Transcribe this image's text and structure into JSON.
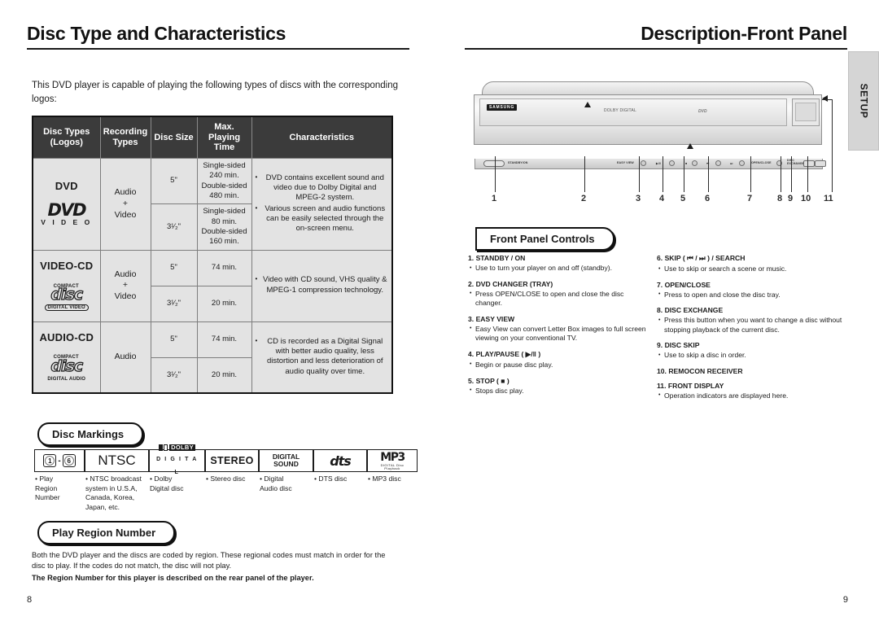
{
  "left": {
    "title": "Disc Type and Characteristics",
    "intro": "This DVD player is capable of playing the following types of discs with the corresponding logos:",
    "page_number": "8",
    "table": {
      "headers": [
        {
          "line1": "Disc Types",
          "line2": "(Logos)"
        },
        {
          "line1": "Recording",
          "line2": "Types"
        },
        {
          "line1": "Disc Size",
          "line2": ""
        },
        {
          "line1": "Max.",
          "line2": "Playing Time"
        },
        {
          "line1": "Characteristics",
          "line2": ""
        }
      ],
      "rows": [
        {
          "disc_type": "DVD",
          "logo": "dvd-video-logo",
          "logo_text_main": "DVD",
          "logo_text_sub": "V I D E O",
          "recording_types": "Audio\n+\nVideo",
          "sizes": [
            {
              "size": "5\"",
              "time": "Single-sided\n240 min.\nDouble-sided\n480 min."
            },
            {
              "size": "3¹⁄₂\"",
              "time": "Single-sided\n80 min.\nDouble-sided\n160 min."
            }
          ],
          "characteristics": [
            "DVD contains excellent sound and video due to Dolby Digital and MPEG-2 system.",
            "Various screen and audio functions can be easily selected through the on-screen menu."
          ]
        },
        {
          "disc_type": "VIDEO-CD",
          "logo": "compact-disc-digital-video-logo",
          "logo_top": "COMPACT",
          "logo_word": "disc",
          "logo_bottom": "DIGITAL VIDEO",
          "recording_types": "Audio\n+\nVideo",
          "sizes": [
            {
              "size": "5\"",
              "time": "74 min."
            },
            {
              "size": "3¹⁄₂\"",
              "time": "20 min."
            }
          ],
          "characteristics": [
            "Video with CD sound, VHS quality & MPEG-1 compression technology."
          ]
        },
        {
          "disc_type": "AUDIO-CD",
          "logo": "compact-disc-digital-audio-logo",
          "logo_top": "COMPACT",
          "logo_word": "disc",
          "logo_bottom": "DIGITAL AUDIO",
          "recording_types": "Audio",
          "sizes": [
            {
              "size": "5\"",
              "time": "74 min."
            },
            {
              "size": "3¹⁄₂\"",
              "time": "20 min."
            }
          ],
          "characteristics": [
            "CD is recorded as a Digital Signal with better audio quality, less distortion and less deterioration of audio quality over time."
          ]
        }
      ]
    },
    "disc_markings": {
      "heading": "Disc Markings",
      "items": [
        {
          "icon": "play-region-number-icon",
          "glyph_a": "1",
          "glyph_b": "6",
          "caption": "Play Region Number"
        },
        {
          "icon": "ntsc-icon",
          "glyph": "NTSC",
          "caption": "NTSC broadcast system in U.S.A, Canada, Korea, Japan, etc."
        },
        {
          "icon": "dolby-digital-icon",
          "glyph_top": "DOLBY",
          "glyph_bottom": "D I G I T A L",
          "caption": "Dolby Digital disc"
        },
        {
          "icon": "stereo-icon",
          "glyph": "STEREO",
          "caption": "Stereo disc"
        },
        {
          "icon": "digital-sound-icon",
          "glyph_top": "DIGITAL",
          "glyph_bottom": "SOUND",
          "caption": "Digital Audio disc"
        },
        {
          "icon": "dts-icon",
          "glyph": "dts",
          "caption": "DTS disc"
        },
        {
          "icon": "mp3-icon",
          "glyph": "MP3",
          "glyph_sub": "DIGITAL Disc Playback",
          "caption": "MP3 disc"
        }
      ]
    },
    "play_region": {
      "heading": "Play Region Number",
      "body": "Both the DVD player and the discs are coded by region. These regional codes must match in order for the disc to play. If the codes do not match, the disc will not play.",
      "bold_note": "The Region Number for this player is described on the rear panel of the player."
    }
  },
  "right": {
    "title": "Description-Front Panel",
    "page_number": "9",
    "setup_tab": "SETUP",
    "panel": {
      "brand": "SAMSUNG",
      "dolby_mark": "DOLBY DIGITAL",
      "dvd_mark": "DVD",
      "button_labels": [
        "STANDBY/ON",
        "EASY VIEW",
        "OPEN/CLOSE",
        "DISC EXCHANGE",
        "DISC SKIP"
      ],
      "callout_numbers": [
        "1",
        "2",
        "3",
        "4",
        "5",
        "6",
        "7",
        "8",
        "9",
        "10",
        "11"
      ]
    },
    "front_panel_controls": {
      "heading": "Front Panel Controls",
      "column_a": [
        {
          "number": "1.",
          "title": "STANDBY / ON",
          "desc": "Use to turn your player on and off (standby)."
        },
        {
          "number": "2.",
          "title": "DVD CHANGER (TRAY)",
          "desc": "Press OPEN/CLOSE to open and close the disc changer."
        },
        {
          "number": "3.",
          "title": "EASY VIEW",
          "desc": "Easy View can convert Letter Box images to full screen viewing on your conventional TV."
        },
        {
          "number": "4.",
          "title": "PLAY/PAUSE ( ▶/‖ )",
          "desc": "Begin or pause disc play."
        },
        {
          "number": "5.",
          "title": "STOP ( ■ )",
          "desc": "Stops disc play."
        }
      ],
      "column_b": [
        {
          "number": "6.",
          "title": "SKIP ( ⏮ / ⏭ ) / SEARCH",
          "desc": "Use to skip or search a scene or music."
        },
        {
          "number": "7.",
          "title": "OPEN/CLOSE",
          "desc": "Press to open and close the disc tray."
        },
        {
          "number": "8.",
          "title": "DISC EXCHANGE",
          "desc": "Press this button when you want to change a disc without stopping playback of the current disc."
        },
        {
          "number": "9.",
          "title": "DISC SKIP",
          "desc": "Use to skip a disc in order."
        },
        {
          "number": "10.",
          "title": "REMOCON RECEIVER",
          "desc": ""
        },
        {
          "number": "11.",
          "title": "FRONT DISPLAY",
          "desc": "Operation indicators are displayed here."
        }
      ]
    }
  },
  "colors": {
    "header_bg": "#3b3b3b",
    "cell_bg": "#e3e3e3",
    "text": "#1a1a1a",
    "setup_tab_bg": "#d5d5d5"
  }
}
